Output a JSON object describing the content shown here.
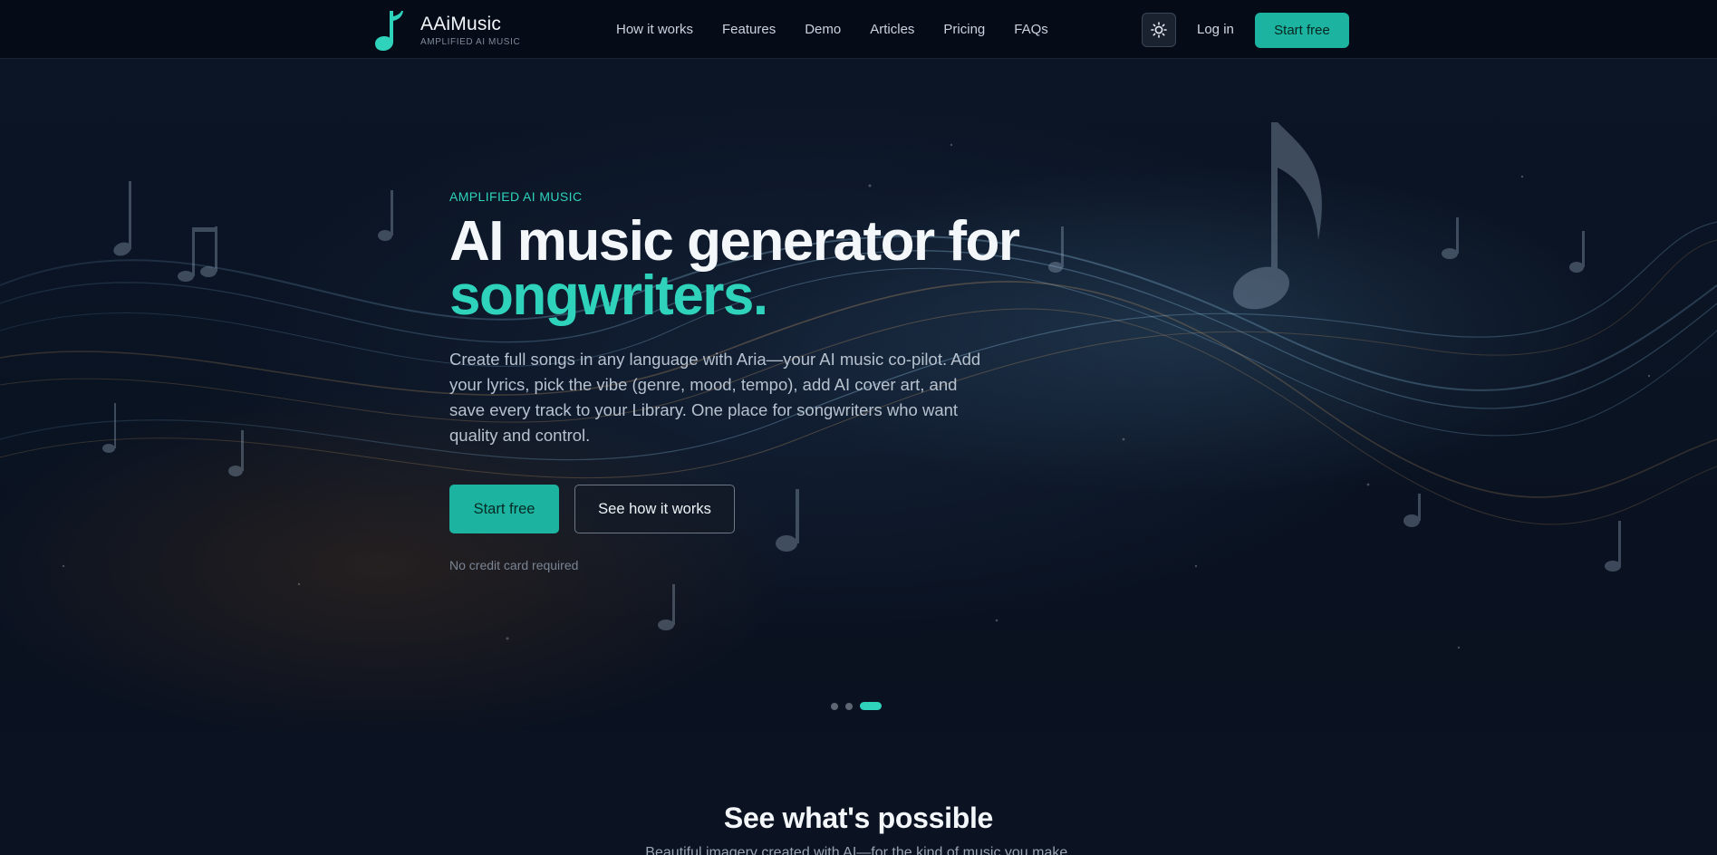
{
  "brand": {
    "name": "AAiMusic",
    "tagline": "AMPLIFIED AI MUSIC",
    "logo_icon": "music-note-icon",
    "accent_color": "#2fd3bb",
    "button_color": "#1cb3a0"
  },
  "nav": {
    "items": [
      "How it works",
      "Features",
      "Demo",
      "Articles",
      "Pricing",
      "FAQs"
    ],
    "theme_icon": "sun-icon",
    "login": "Log in",
    "start": "Start free"
  },
  "hero": {
    "eyebrow": "AMPLIFIED AI MUSIC",
    "title_line1": "AI music generator for",
    "title_line2": "songwriters.",
    "description": "Create full songs in any language with Aria—your AI music co-pilot. Add your lyrics, pick the vibe (genre, mood, tempo), add AI cover art, and save every track to your Library. One place for songwriters who want quality and control.",
    "primary_button": "Start free",
    "secondary_button": "See how it works",
    "note": "No credit card required",
    "carousel": {
      "slides": 3,
      "active": 3
    }
  },
  "section": {
    "title": "See what's possible",
    "subtitle": "Beautiful imagery created with AI—for the kind of music you make."
  }
}
